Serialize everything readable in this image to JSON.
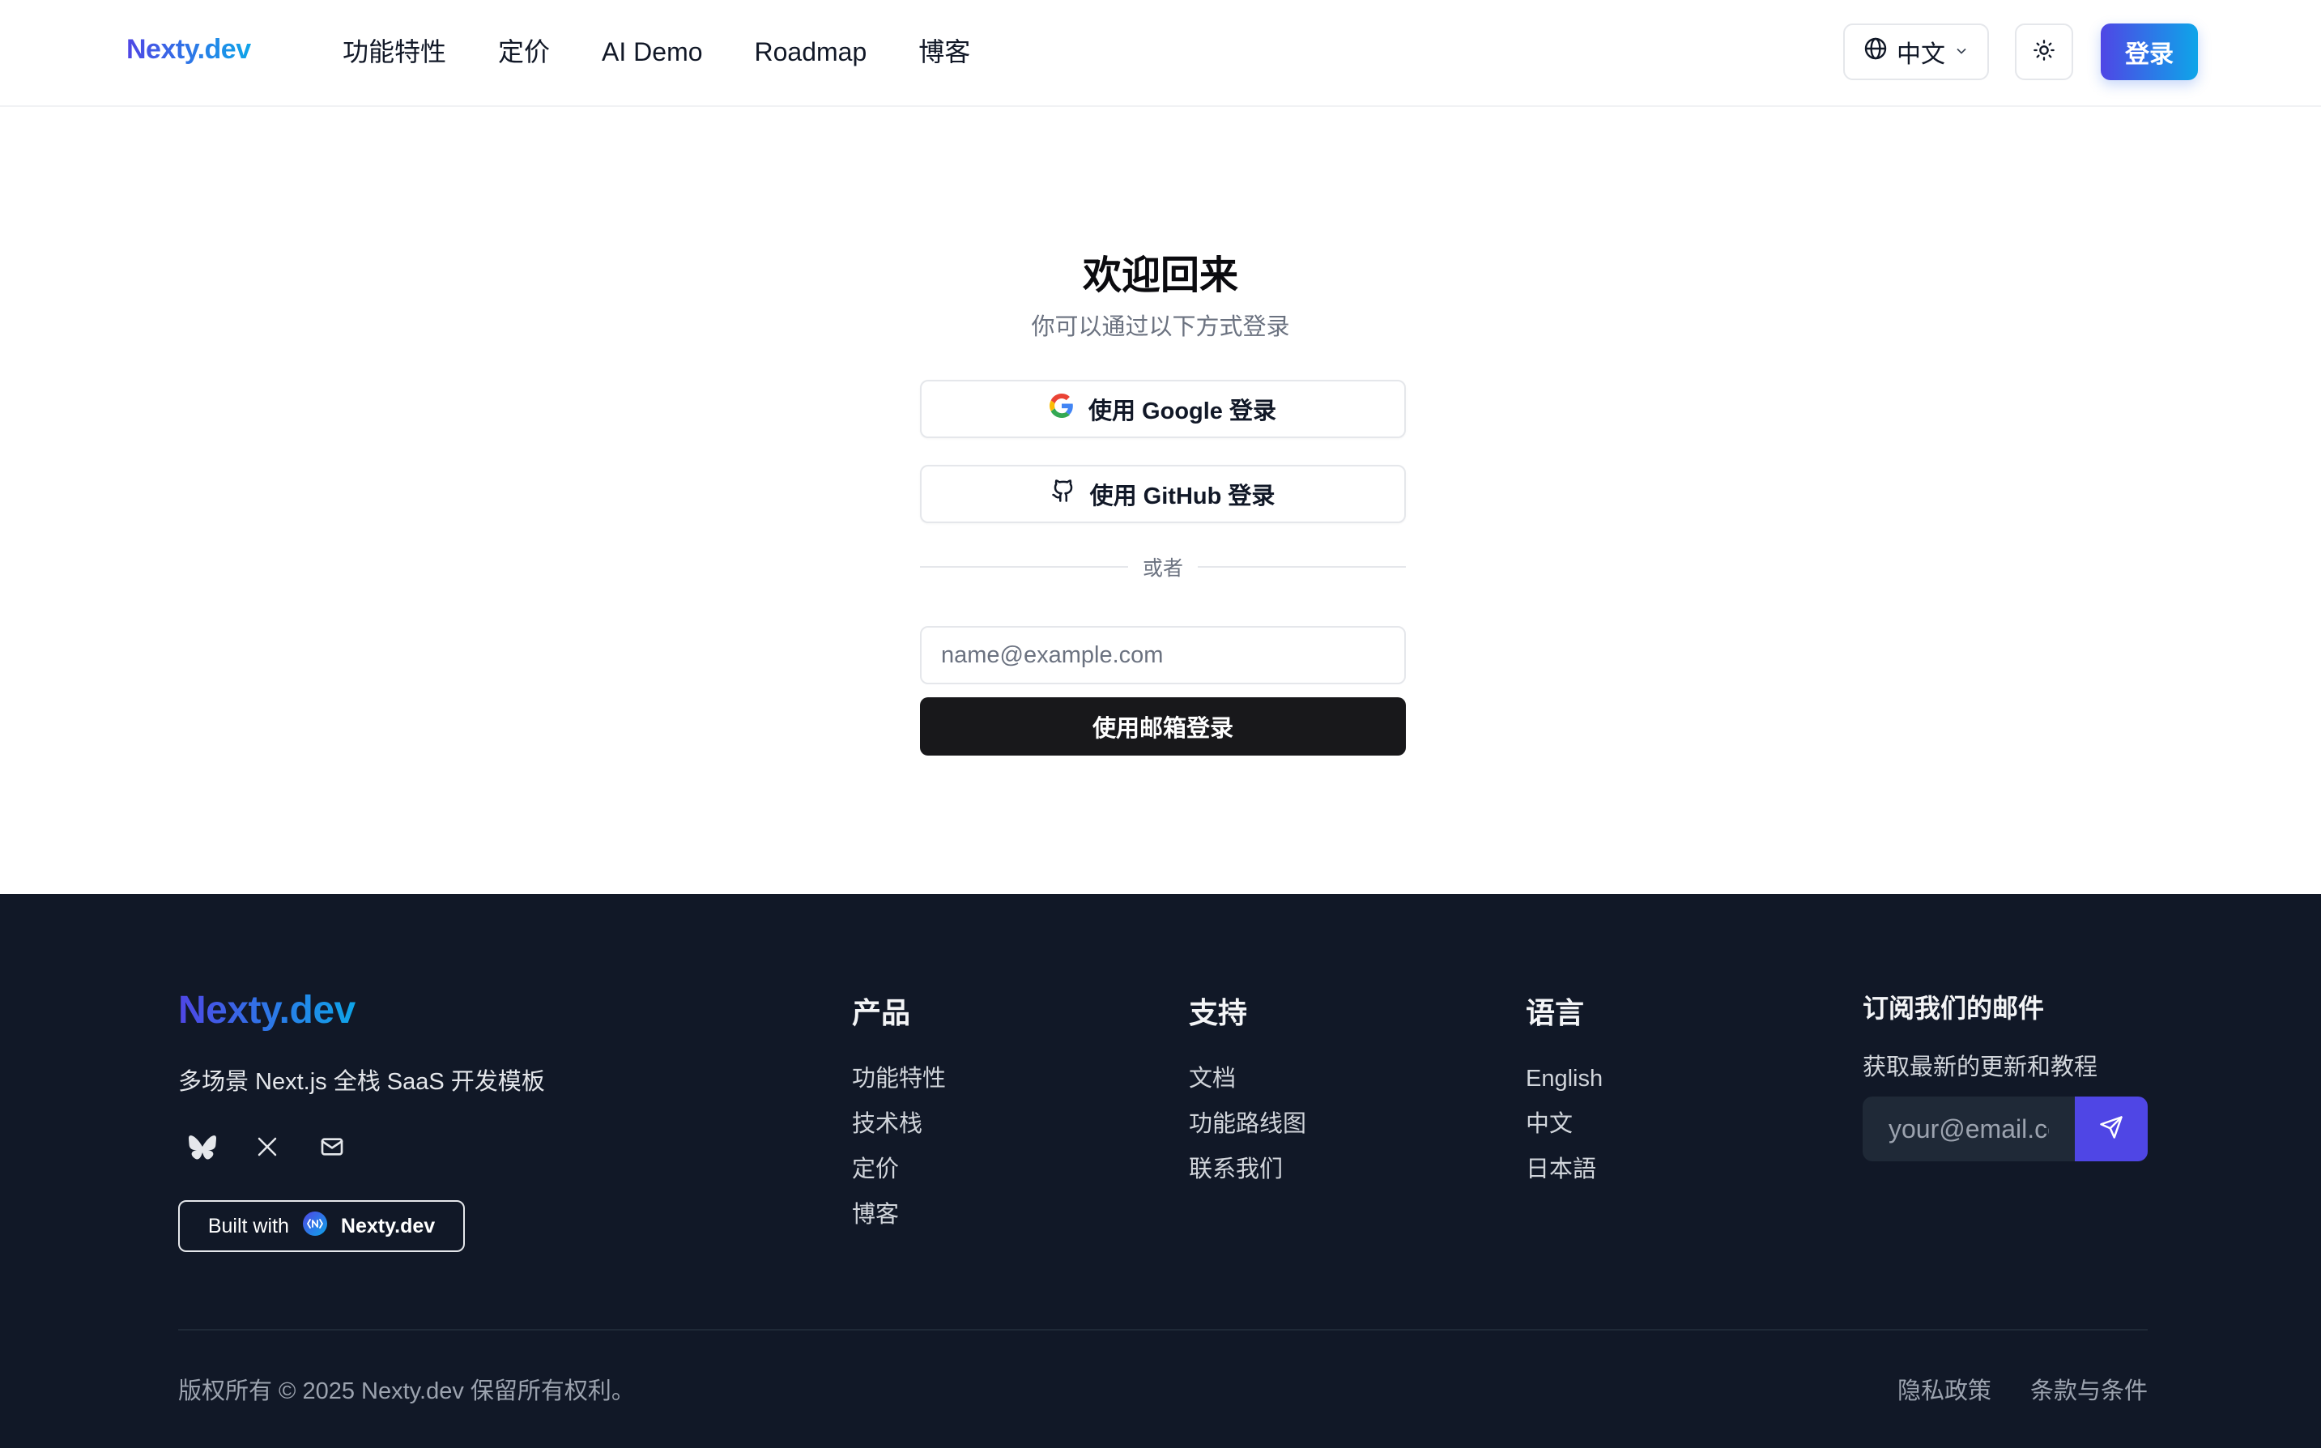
{
  "header": {
    "logo": "Nexty.dev",
    "nav": [
      "功能特性",
      "定价",
      "AI Demo",
      "Roadmap",
      "博客"
    ],
    "language": "中文",
    "login_label": "登录"
  },
  "auth": {
    "title": "欢迎回来",
    "subtitle": "你可以通过以下方式登录",
    "google_label": "使用 Google 登录",
    "github_label": "使用 GitHub 登录",
    "divider": "或者",
    "email_placeholder": "name@example.com",
    "email_submit": "使用邮箱登录"
  },
  "footer": {
    "logo": "Nexty.dev",
    "tagline": "多场景 Next.js 全栈 SaaS 开发模板",
    "socials": [
      "bluesky-icon",
      "x-icon",
      "mail-icon"
    ],
    "built_with": "Built with",
    "built_brand": "Nexty.dev",
    "product": {
      "title": "产品",
      "links": [
        "功能特性",
        "技术栈",
        "定价",
        "博客"
      ]
    },
    "support": {
      "title": "支持",
      "links": [
        "文档",
        "功能路线图",
        "联系我们"
      ]
    },
    "languages": {
      "title": "语言",
      "links": [
        "English",
        "中文",
        "日本語"
      ]
    },
    "subscribe": {
      "title": "订阅我们的邮件",
      "subtitle": "获取最新的更新和教程",
      "placeholder": "your@email.com"
    },
    "copyright": "版权所有 © 2025 Nexty.dev 保留所有权利。",
    "legal": [
      "隐私政策",
      "条款与条件"
    ]
  },
  "colors": {
    "brand_start": "#4f46e5",
    "brand_end": "#0ea5e9",
    "footer_bg": "#111827",
    "primary_button": "#18181b"
  }
}
